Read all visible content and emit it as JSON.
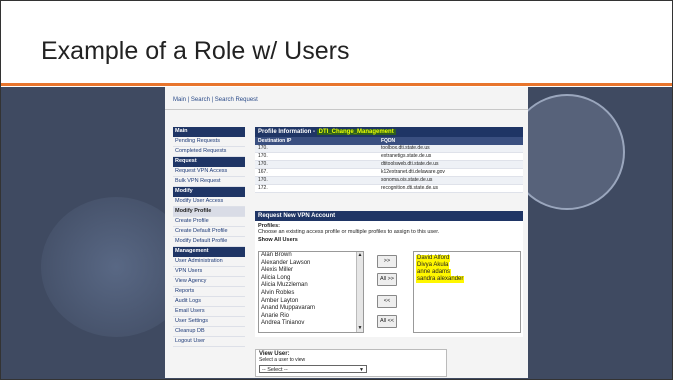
{
  "slide": {
    "title": "Example of a Role w/ Users"
  },
  "app": {
    "top_nav": "Main | Search | Search Request",
    "sidebar": {
      "items": [
        {
          "label": "Main",
          "type": "head"
        },
        {
          "label": "Pending Requests"
        },
        {
          "label": "Completed Requests"
        },
        {
          "label": "Request",
          "type": "head"
        },
        {
          "label": "Request VPN Access"
        },
        {
          "label": "Bulk VPN Request"
        },
        {
          "label": "Modify",
          "type": "head"
        },
        {
          "label": "Modify User Access"
        },
        {
          "label": "Modify Profile",
          "type": "sel"
        },
        {
          "label": "Create Profile"
        },
        {
          "label": "Create Default Profile"
        },
        {
          "label": "Modify Default Profile"
        },
        {
          "label": "Management",
          "type": "head"
        },
        {
          "label": "User Administration"
        },
        {
          "label": "VPN Users"
        },
        {
          "label": "View Agency"
        },
        {
          "label": "Reports"
        },
        {
          "label": "Audit Logs"
        },
        {
          "label": "Email Users"
        },
        {
          "label": "User Settings"
        },
        {
          "label": "Cleanup DB"
        },
        {
          "label": "Logout User"
        }
      ]
    },
    "profile_info": {
      "header": "Profile Information - ",
      "profile_name": "DTI_Change_Management",
      "col_dest": "Destination IP",
      "col_fqdn": "FQDN",
      "rows": [
        {
          "ip": "170.",
          "fqdn": "toolbox.dti.state.de.us"
        },
        {
          "ip": "170.",
          "fqdn": "extranetigs.state.de.us"
        },
        {
          "ip": "170.",
          "fqdn": "dtitoolsweb.dti.state.de.us"
        },
        {
          "ip": "167.",
          "fqdn": "k12extranet.dti.delaware.gov"
        },
        {
          "ip": "170.",
          "fqdn": "sonoma.ois.state.de.us"
        },
        {
          "ip": "172.",
          "fqdn": "recognition.dti.state.de.us"
        }
      ]
    },
    "vpn": {
      "header": "Request New VPN Account",
      "profiles_label": "Profiles:",
      "profiles_desc": "Choose an existing access profile or multiple profiles to assign to this user.",
      "show_all": "Show All Users",
      "available_users": [
        "Alan Brown",
        "Alexander Lawson",
        "Alexis Miller",
        "Alicia Long",
        "Alicia Muzzleman",
        "Alvin Robles",
        "Amber Layton",
        "Anand Muppavaram",
        "Anarie Rio",
        "Andrea Tinianov"
      ],
      "assigned_users": [
        "David Alford",
        "Divya Akula",
        "anne adams",
        "sandra alexander"
      ],
      "buttons": {
        "add": ">>",
        "add_all": "All >>",
        "remove": "<<",
        "remove_all": "All <<"
      }
    },
    "view_user": {
      "title": "View User:",
      "subtitle": "Select a user to view",
      "select_value": "-- Select --"
    }
  },
  "colors": {
    "accent": "#e8752d",
    "panel": "#3f4a61",
    "nav_header": "#1f3565",
    "highlight": "#fff700"
  }
}
